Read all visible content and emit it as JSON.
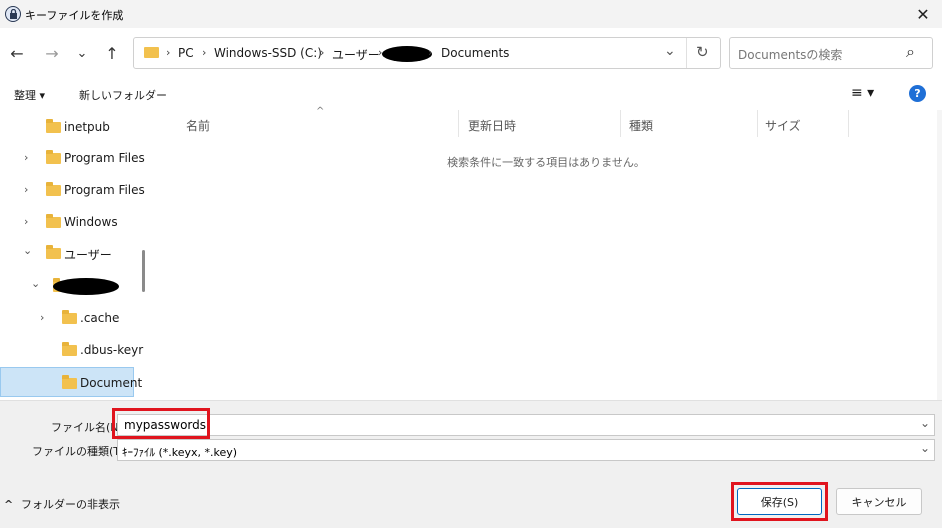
{
  "window": {
    "title": "キーファイルを作成",
    "close_glyph": "✕"
  },
  "nav": {
    "back_glyph": "←",
    "forward_glyph": "→",
    "dropdown_glyph": "⌄",
    "up_glyph": "↑"
  },
  "address": {
    "crumbs": [
      "PC",
      "Windows-SSD (C:)",
      "ユーザー",
      "Documents"
    ],
    "separator": "›",
    "dropdown_glyph": "⌄",
    "refresh_glyph": "↻"
  },
  "search": {
    "placeholder": "Documentsの検索",
    "icon_glyph": "⌕"
  },
  "toolbar": {
    "organize_label": "整理 ▾",
    "new_folder_label": "新しいフォルダー",
    "view_glyph": "≡ ▾",
    "help_glyph": "?"
  },
  "sidebar": {
    "items": [
      {
        "label": "inetpub",
        "chevron": ""
      },
      {
        "label": "Program Files",
        "chevron": "›"
      },
      {
        "label": "Program Files",
        "chevron": "›"
      },
      {
        "label": "Windows",
        "chevron": "›"
      },
      {
        "label": "ユーザー",
        "chevron": "⌄"
      },
      {
        "label": "",
        "chevron": "⌄"
      },
      {
        "label": ".cache",
        "chevron": "›"
      },
      {
        "label": ".dbus-keyr",
        "chevron": ""
      },
      {
        "label": "Document",
        "chevron": ""
      }
    ]
  },
  "filepane": {
    "sort_glyph": "^",
    "columns": [
      "名前",
      "更新日時",
      "種類",
      "サイズ"
    ],
    "empty_message": "検索条件に一致する項目はありません。"
  },
  "form": {
    "filename_label": "ファイル名(N):",
    "filename_value": "mypasswords",
    "filetype_label": "ファイルの種類(T):",
    "filetype_value": "ｷｰﾌｧｲﾙ (*.keyx, *.key)",
    "dropdown_glyph": "⌄"
  },
  "footer": {
    "hide_folders_label": "フォルダーの非表示",
    "hide_glyph": "^",
    "save_label": "保存(S)",
    "cancel_label": "キャンセル"
  },
  "colors": {
    "highlight_red": "#e0141e",
    "selected_bg": "#cce4f7",
    "help_blue": "#1f6fd6",
    "folder_yellow": "#f2c14e"
  }
}
